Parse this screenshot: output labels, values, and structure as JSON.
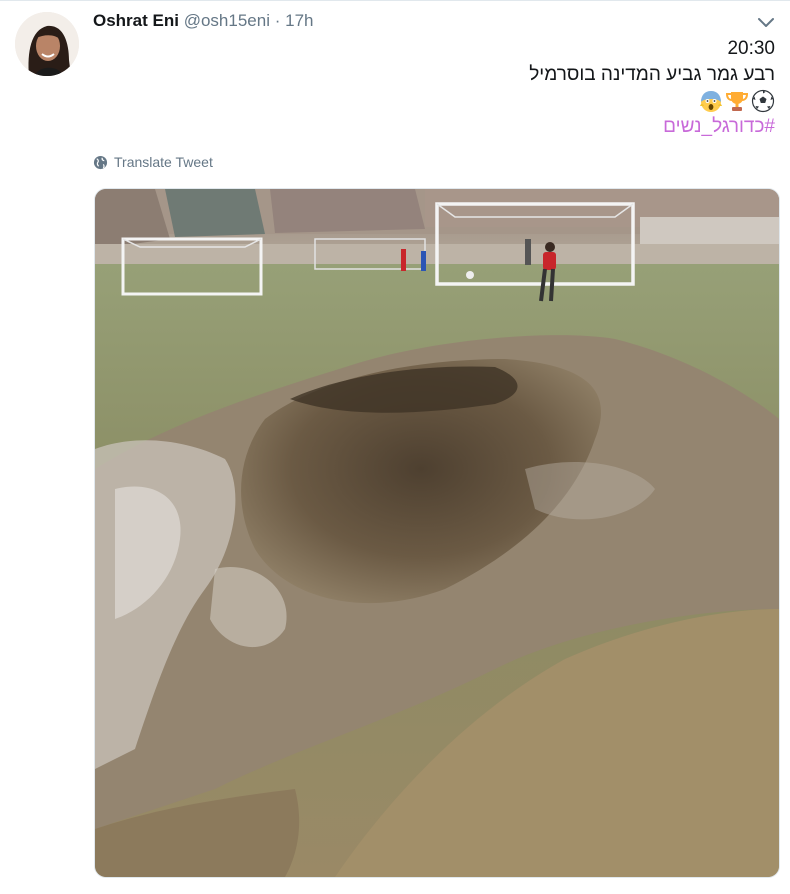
{
  "tweet": {
    "display_name": "Oshrat Eni",
    "handle": "@osh15eni",
    "separator": "·",
    "time_ago": "17h",
    "text_lines": [
      "20:30",
      "רבע גמר גביע המדינה בוסרמיל"
    ],
    "emojis": [
      "soccer-ball-emoji",
      "trophy-emoji",
      "screaming-face-emoji"
    ],
    "hashtag": "#כדורגל_נשים",
    "translate_label": "Translate Tweet"
  },
  "icons": {
    "more": "chevron-down-icon",
    "translate": "globe-icon"
  },
  "colors": {
    "hashtag": "#c86ad9",
    "meta_text": "#657786",
    "name_text": "#14171a"
  }
}
